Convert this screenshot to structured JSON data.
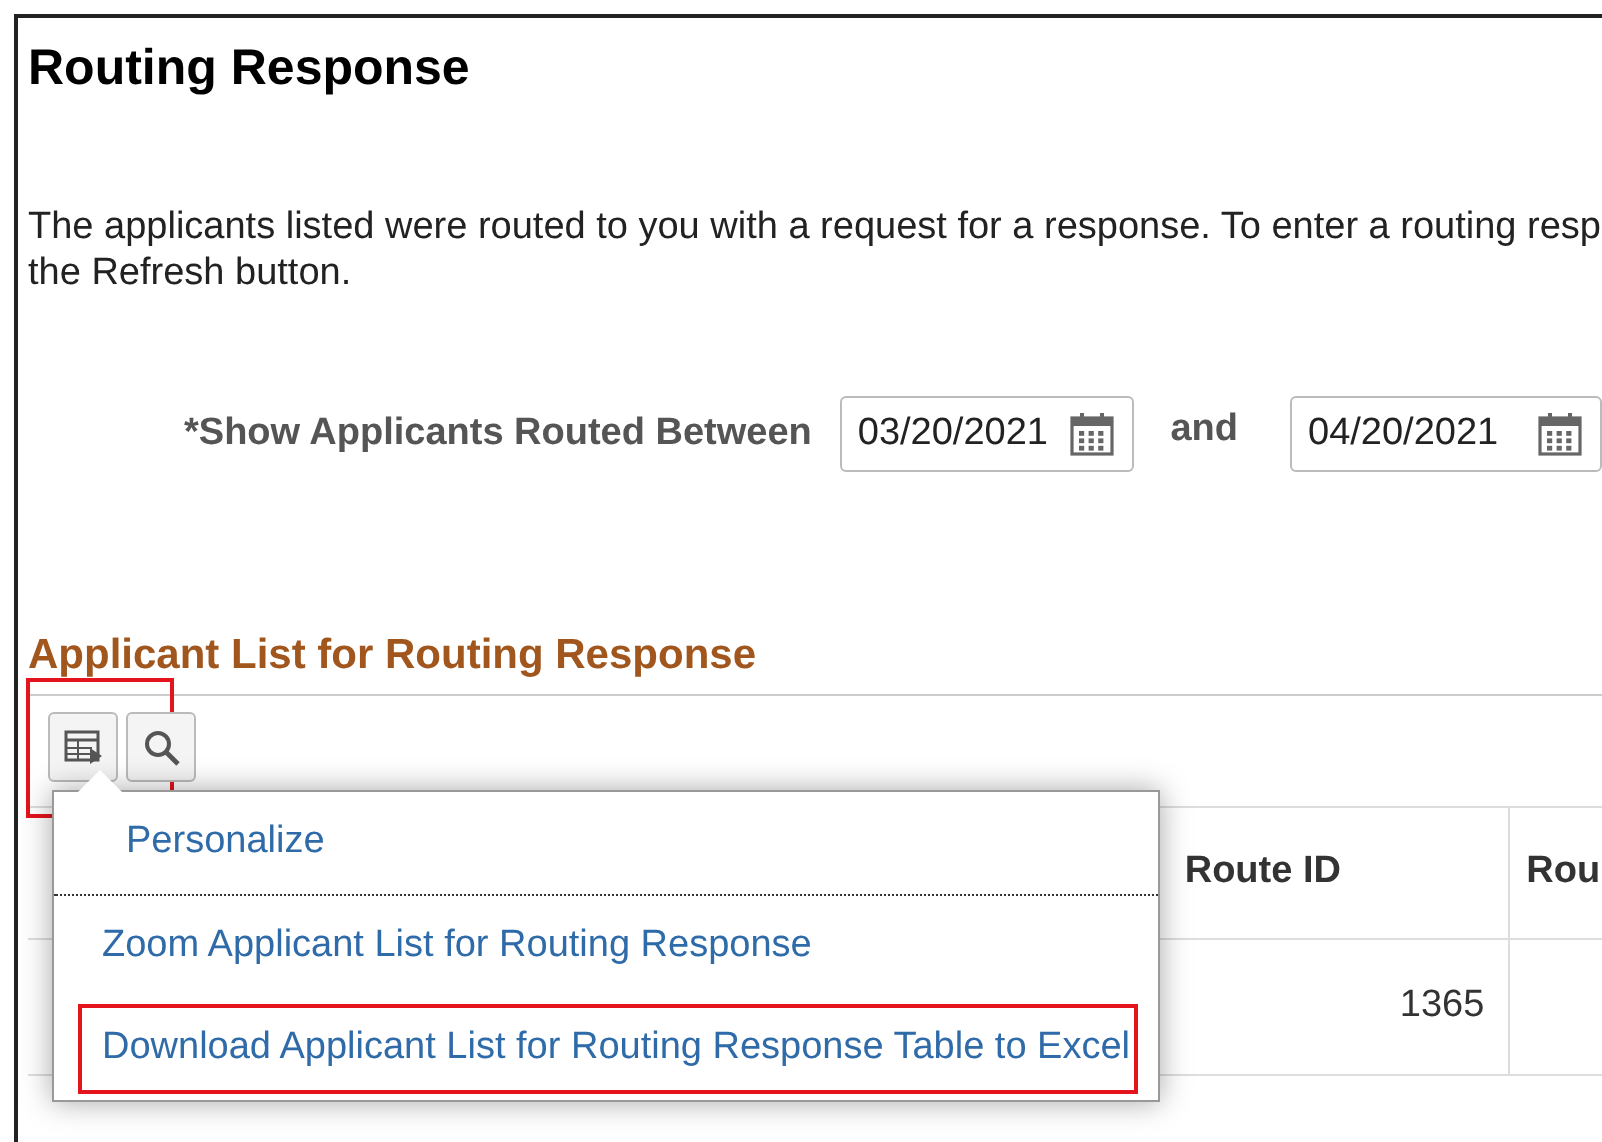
{
  "page_title": "Routing Response",
  "instructions": [
    "The applicants listed were routed to you with a request for a response. To enter a routing resp",
    "the Refresh button."
  ],
  "date_range": {
    "label": "*Show Applicants Routed Between",
    "from": "03/20/2021",
    "joiner": "and",
    "to": "04/20/2021"
  },
  "section_title": "Applicant List for Routing Response",
  "toolbar": [
    {
      "kind": "grid",
      "highlighted": true
    },
    {
      "kind": "search",
      "highlighted": false
    }
  ],
  "table": {
    "columns": [
      "Route ID",
      "Rou"
    ],
    "rows": [
      {
        "route_id": "1365"
      }
    ]
  },
  "menu": {
    "items": [
      {
        "label": "Personalize",
        "highlighted": false
      },
      {
        "label": "Zoom Applicant List for Routing Response",
        "highlighted": false
      },
      {
        "label": "Download Applicant List for Routing Response Table to Excel",
        "highlighted": true
      }
    ]
  }
}
